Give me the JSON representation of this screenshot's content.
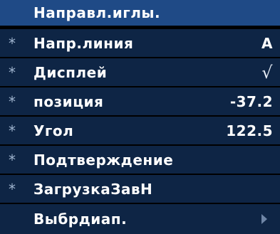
{
  "menu": {
    "title": "Направл.иглы.",
    "items": [
      {
        "marker": "*",
        "label": "Напр.линия",
        "value": "A"
      },
      {
        "marker": "*",
        "label": "Дисплей",
        "value": "√"
      },
      {
        "marker": "*",
        "label": "позиция",
        "value": "-37.2"
      },
      {
        "marker": "*",
        "label": "Угол",
        "value": "122.5"
      },
      {
        "marker": "*",
        "label": "Подтверждение",
        "value": ""
      },
      {
        "marker": "*",
        "label": "ЗагрузкаЗавН",
        "value": ""
      },
      {
        "marker": "",
        "label": "Выбрдиап.",
        "value": "",
        "icon": "triangle-right-icon"
      }
    ]
  },
  "colors": {
    "header_bg": "#1f4a86",
    "item_bg": "#0e2545",
    "text": "#ffffff",
    "marker": "#9fb4cf",
    "arrow": "#6f86a6"
  }
}
